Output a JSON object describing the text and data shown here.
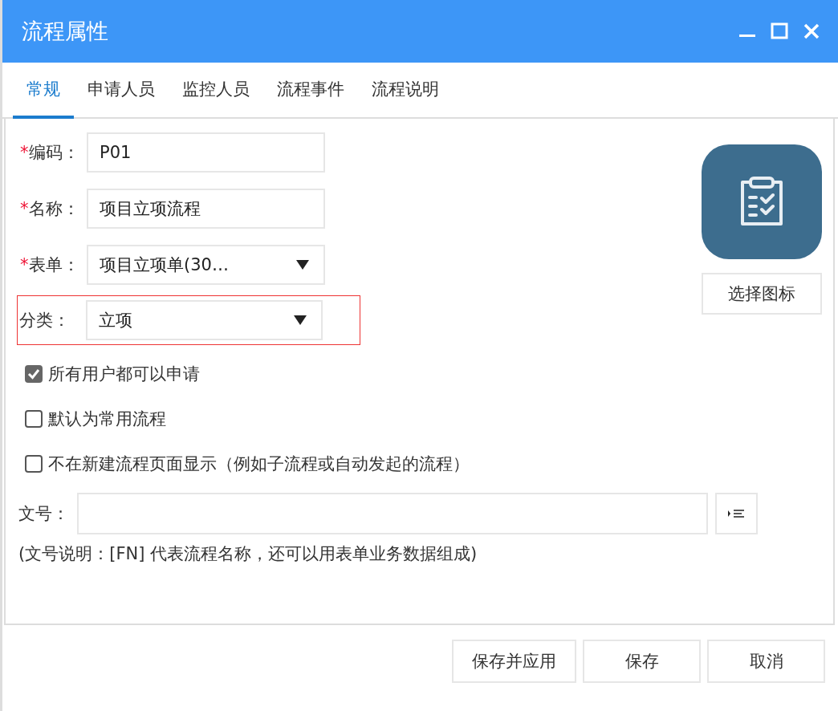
{
  "window": {
    "title": "流程属性"
  },
  "tabs": [
    {
      "label": "常规",
      "selected": true
    },
    {
      "label": "申请人员",
      "selected": false
    },
    {
      "label": "监控人员",
      "selected": false
    },
    {
      "label": "流程事件",
      "selected": false
    },
    {
      "label": "流程说明",
      "selected": false
    }
  ],
  "fields": [
    {
      "label": "编码：",
      "kind": "text",
      "required_mark": "*",
      "highlighted": false,
      "value": "P01"
    },
    {
      "label": "名称：",
      "kind": "text",
      "required_mark": "*",
      "highlighted": false,
      "value": "项目立项流程"
    },
    {
      "label": "表单：",
      "kind": "select",
      "required_mark": "*",
      "highlighted": false,
      "value": "项目立项单(30…"
    },
    {
      "label": "分类：",
      "kind": "select",
      "highlighted": true,
      "value": "立项"
    }
  ],
  "icon_picker": {
    "button": "选择图标"
  },
  "options": [
    {
      "label": "所有用户都可以申请",
      "checked": true
    },
    {
      "label": "默认为常用流程",
      "checked": false
    },
    {
      "label": "不在新建流程页面显示（例如子流程或自动发起的流程）",
      "checked": false
    }
  ],
  "doc_number": {
    "label": "文号：",
    "note": "(文号说明：[FN] 代表流程名称，还可以用表单业务数据组成)"
  },
  "buttons": [
    "保存并应用",
    "保存",
    "取消"
  ]
}
